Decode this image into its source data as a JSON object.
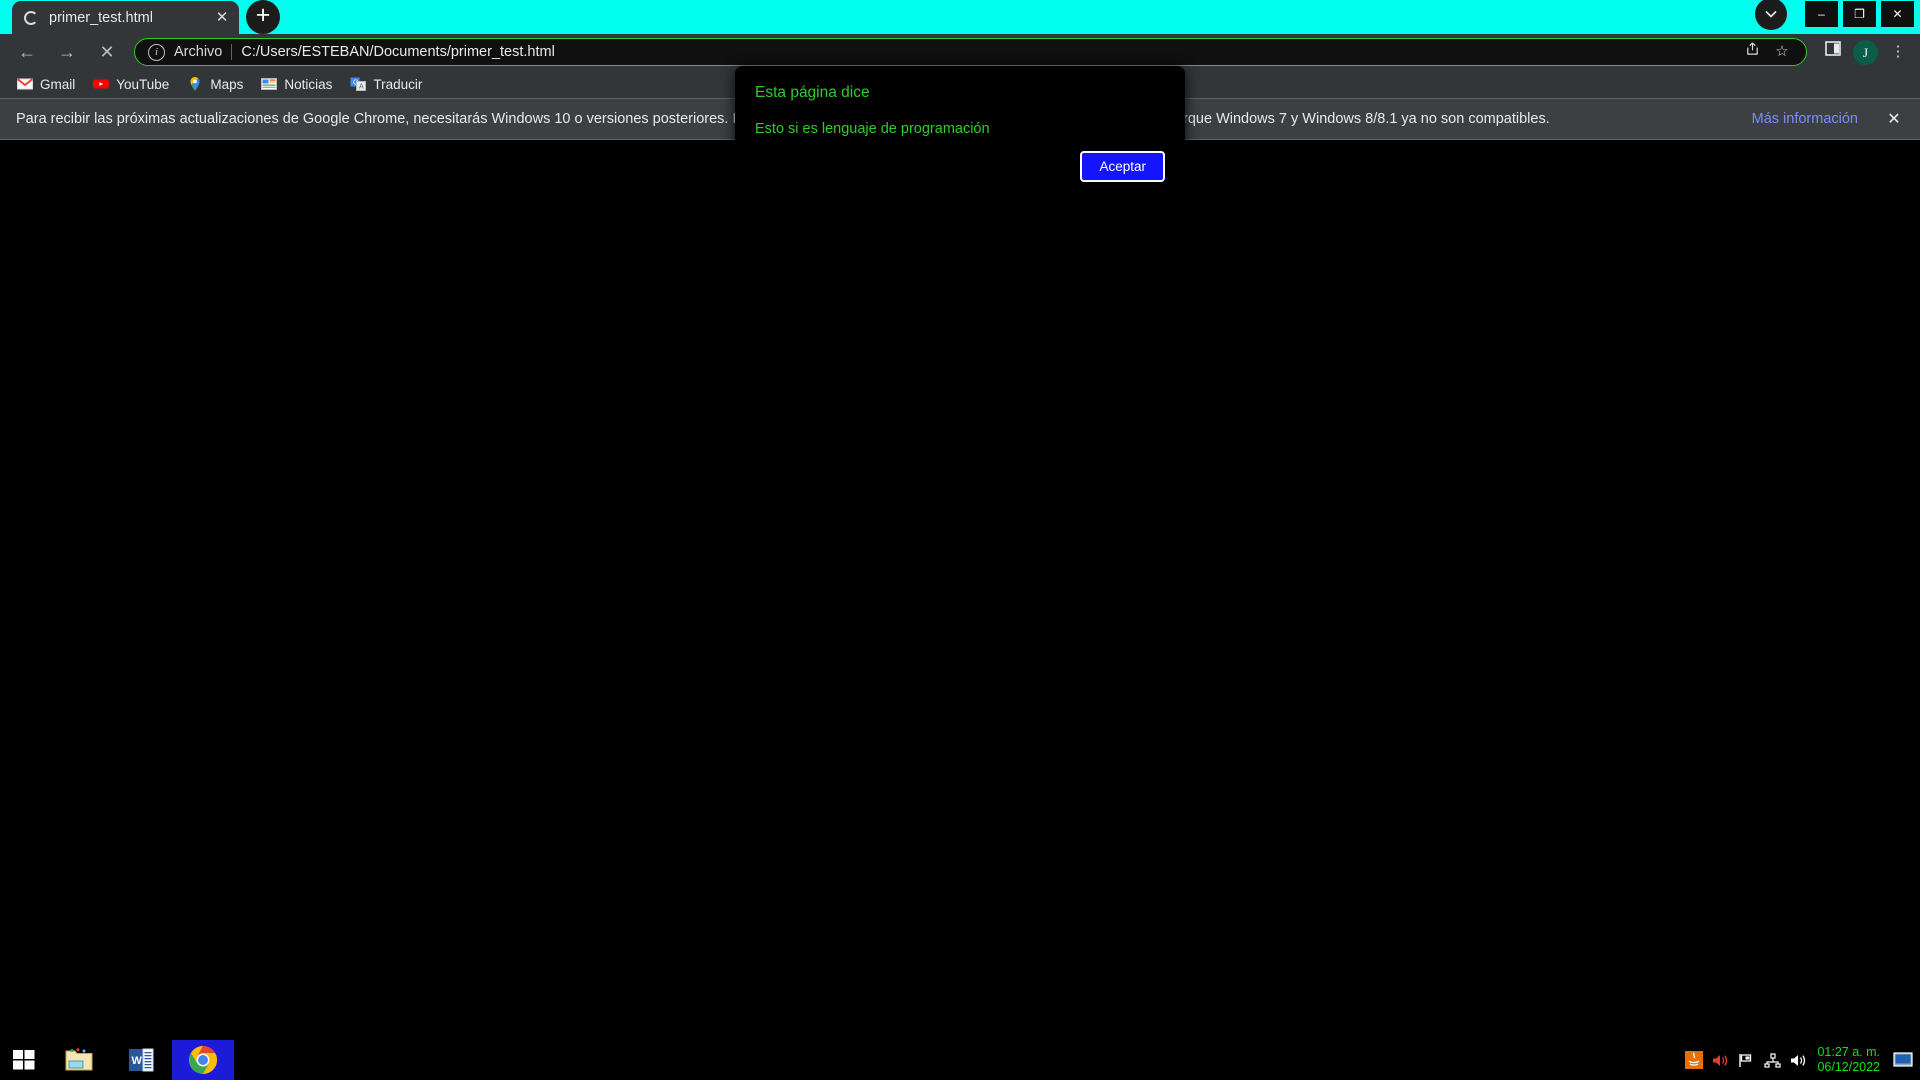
{
  "window": {
    "controls": {
      "chevron": "chevron-down",
      "minimize": "–",
      "maximize": "❐",
      "close": "✕"
    }
  },
  "tabstrip": {
    "tabs": [
      {
        "title": "primer_test.html",
        "loading": true,
        "close_label": "✕"
      }
    ],
    "new_tab_label": "+"
  },
  "toolbar": {
    "back_label": "←",
    "forward_label": "→",
    "stop_label": "✕",
    "omnibox": {
      "security_icon": "info-icon",
      "scheme_label": "Archivo",
      "url": "C:/Users/ESTEBAN/Documents/primer_test.html",
      "share_label": "↱",
      "bookmark_star_label": "☆"
    },
    "side_panel_label": "side-panel",
    "profile_initial": "J",
    "menu_label": "⋮",
    "accent_border_color": "#2ecc27"
  },
  "bookmarks": [
    {
      "label": "Gmail",
      "icon": "gmail-icon"
    },
    {
      "label": "YouTube",
      "icon": "youtube-icon"
    },
    {
      "label": "Maps",
      "icon": "maps-icon"
    },
    {
      "label": "Noticias",
      "icon": "news-icon"
    },
    {
      "label": "Traducir",
      "icon": "translate-icon"
    }
  ],
  "infobar": {
    "text": "Para recibir las próximas actualizaciones de Google Chrome, necesitarás Windows 10 o versiones posteriores. Esta computadora ya no recibe actualizaciones de Google Chrome porque Windows 7 y Windows 8/8.1 ya no son compatibles.",
    "link": "Más información",
    "close": "✕"
  },
  "dialog": {
    "title": "Esta página dice",
    "message": "Esto si es lenguaje de programación",
    "ok_label": "Aceptar",
    "text_color": "#2ecc27",
    "button_color": "#1414ff"
  },
  "page": {
    "background_color": "#000000"
  },
  "taskbar": {
    "start_label": "start-icon",
    "apps": [
      {
        "name": "file-explorer",
        "active": false
      },
      {
        "name": "microsoft-word",
        "active": false
      },
      {
        "name": "google-chrome",
        "active": true
      }
    ],
    "tray": [
      {
        "name": "java-icon"
      },
      {
        "name": "volume-muted-icon"
      },
      {
        "name": "flag-icon"
      },
      {
        "name": "network-icon"
      },
      {
        "name": "speaker-icon"
      }
    ],
    "clock": {
      "time": "01:27 a. m.",
      "date": "06/12/2022",
      "color": "#16e016"
    },
    "show_desktop": "show-desktop"
  }
}
